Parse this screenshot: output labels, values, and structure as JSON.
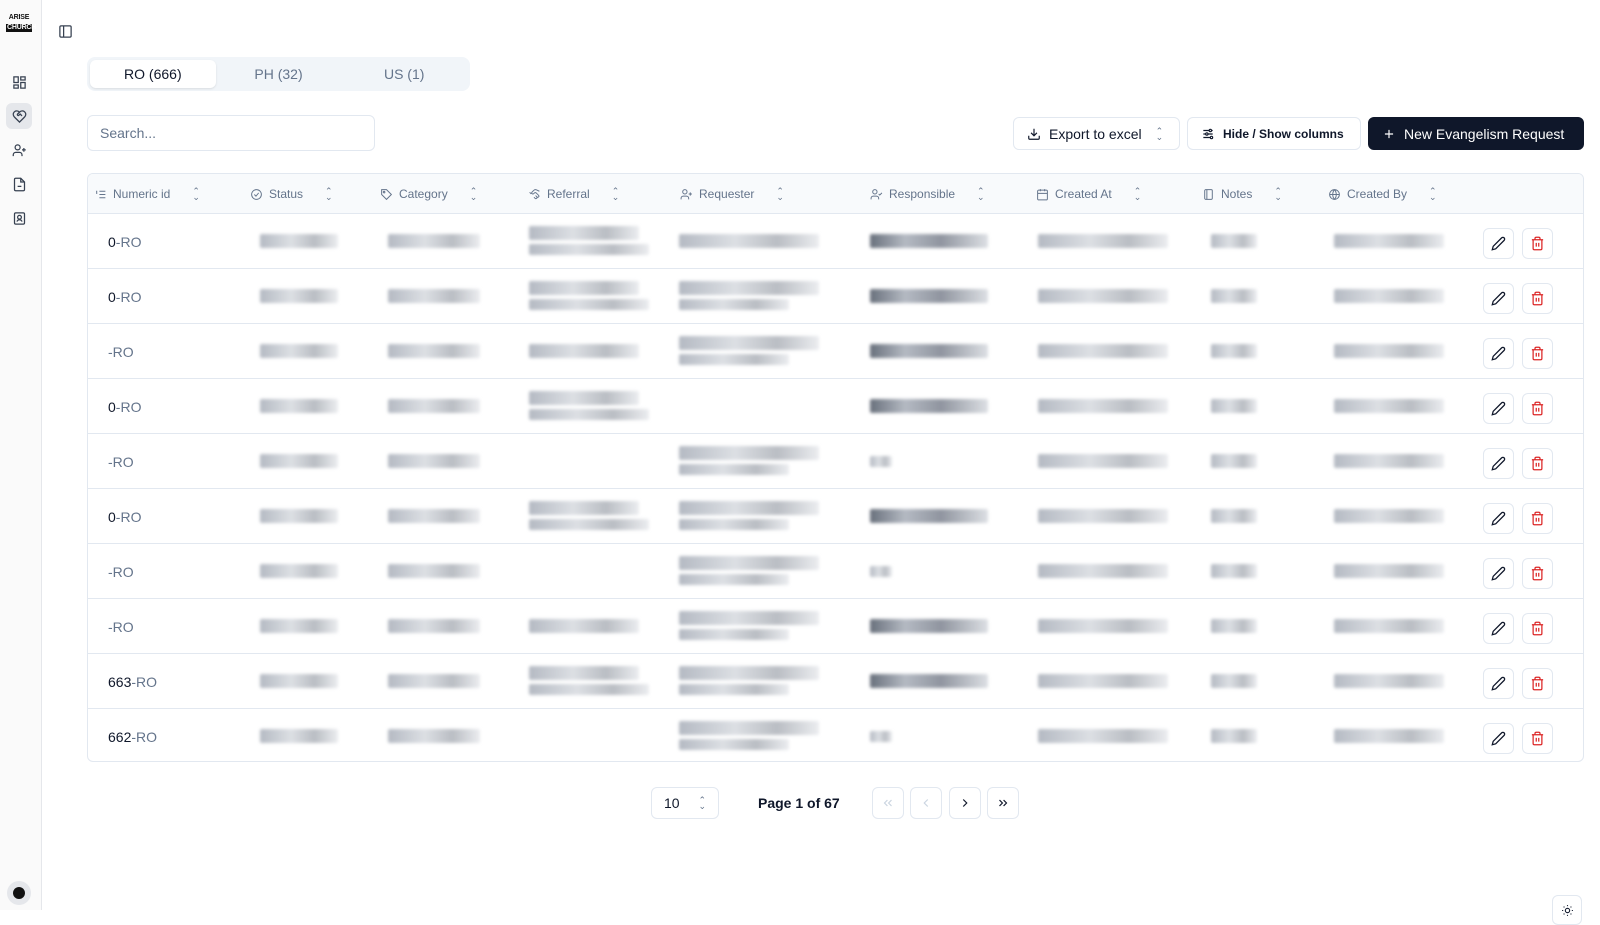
{
  "sidebar": {
    "logo_line1": "ARISE",
    "logo_line2": "CHURCH",
    "icons": [
      "dashboard-icon",
      "handshake-heart-icon",
      "user-plus-icon",
      "document-icon",
      "contact-book-icon"
    ],
    "active_index": 1
  },
  "tabs": [
    {
      "label": "RO (666)",
      "active": true
    },
    {
      "label": "PH (32)",
      "active": false
    },
    {
      "label": "US (1)",
      "active": false
    }
  ],
  "search": {
    "placeholder": "Search..."
  },
  "toolbar": {
    "export_label": "Export to excel",
    "columns_label": "Hide / Show columns",
    "new_label": "New Evangelism Request"
  },
  "table": {
    "columns": [
      "Numeric id",
      "Status",
      "Category",
      "Referral",
      "Requester",
      "Responsible",
      "Created At",
      "Notes",
      "Created By"
    ],
    "rows": [
      {
        "num": "0",
        "suffix": "-RO"
      },
      {
        "num": "0",
        "suffix": "-RO"
      },
      {
        "num": "",
        "suffix": "-RO"
      },
      {
        "num": "0",
        "suffix": "-RO"
      },
      {
        "num": "",
        "suffix": "-RO"
      },
      {
        "num": "0",
        "suffix": "-RO"
      },
      {
        "num": "",
        "suffix": "-RO"
      },
      {
        "num": "",
        "suffix": "-RO"
      },
      {
        "num": "663",
        "suffix": "-RO"
      },
      {
        "num": "662",
        "suffix": "-RO"
      }
    ]
  },
  "pagination": {
    "page_size": "10",
    "page_info": "Page 1 of 67"
  },
  "colors": {
    "primary": "#0f172a",
    "danger": "#dc2626",
    "border": "#e2e8f0",
    "muted": "#64748b"
  }
}
